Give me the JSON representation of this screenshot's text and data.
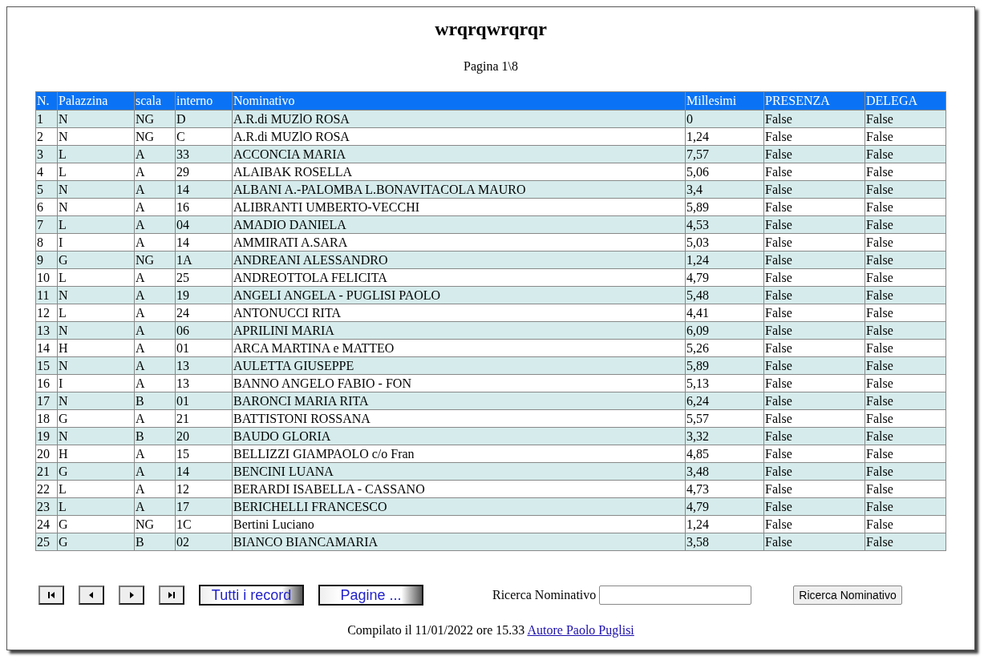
{
  "title": "wrqrqwrqrqr",
  "page_label": "Pagina 1\\8",
  "table": {
    "columns": [
      "N.",
      "Palazzina",
      "scala",
      "interno",
      "Nominativo",
      "Millesimi",
      "PRESENZA",
      "DELEGA"
    ],
    "rows": [
      [
        "1",
        "N",
        "NG",
        "D",
        "A.R.di MUZlO ROSA",
        "0",
        "False",
        "False"
      ],
      [
        "2",
        "N",
        "NG",
        "C",
        "A.R.di MUZlO ROSA",
        "1,24",
        "False",
        "False"
      ],
      [
        "3",
        "L",
        "A",
        "33",
        "ACCONCIA MARIA",
        "7,57",
        "False",
        "False"
      ],
      [
        "4",
        "L",
        "A",
        "29",
        "ALAIBAK ROSELLA",
        "5,06",
        "False",
        "False"
      ],
      [
        "5",
        "N",
        "A",
        "14",
        "ALBANI A.-PALOMBA L.BONAVITACOLA MAURO",
        "3,4",
        "False",
        "False"
      ],
      [
        "6",
        "N",
        "A",
        "16",
        "ALIBRANTI UMBERTO-VECCHI",
        "5,89",
        "False",
        "False"
      ],
      [
        "7",
        "L",
        "A",
        "04",
        "AMADIO DANIELA",
        "4,53",
        "False",
        "False"
      ],
      [
        "8",
        "I",
        "A",
        "14",
        "AMMIRATI A.SARA",
        "5,03",
        "False",
        "False"
      ],
      [
        "9",
        "G",
        "NG",
        "1A",
        "ANDREANI ALESSANDRO",
        "1,24",
        "False",
        "False"
      ],
      [
        "10",
        "L",
        "A",
        "25",
        "ANDREOTTOLA FELICITA",
        "4,79",
        "False",
        "False"
      ],
      [
        "11",
        "N",
        "A",
        "19",
        "ANGELI ANGELA - PUGLISI PAOLO",
        "5,48",
        "False",
        "False"
      ],
      [
        "12",
        "L",
        "A",
        "24",
        "ANTONUCCI RITA",
        "4,41",
        "False",
        "False"
      ],
      [
        "13",
        "N",
        "A",
        "06",
        "APRILINI MARIA",
        "6,09",
        "False",
        "False"
      ],
      [
        "14",
        "H",
        "A",
        "01",
        "ARCA MARTINA e MATTEO",
        "5,26",
        "False",
        "False"
      ],
      [
        "15",
        "N",
        "A",
        "13",
        "AULETTA GIUSEPPE",
        "5,89",
        "False",
        "False"
      ],
      [
        "16",
        "I",
        "A",
        "13",
        "BANNO ANGELO FABIO - FON",
        "5,13",
        "False",
        "False"
      ],
      [
        "17",
        "N",
        "B",
        "01",
        "BARONCI MARIA RITA",
        "6,24",
        "False",
        "False"
      ],
      [
        "18",
        "G",
        "A",
        "21",
        "BATTISTONI ROSSANA",
        "5,57",
        "False",
        "False"
      ],
      [
        "19",
        "N",
        "B",
        "20",
        "BAUDO GLORIA",
        "3,32",
        "False",
        "False"
      ],
      [
        "20",
        "H",
        "A",
        "15",
        "BELLIZZI GIAMPAOLO c/o Fran",
        "4,85",
        "False",
        "False"
      ],
      [
        "21",
        "G",
        "A",
        "14",
        "BENCINI LUANA",
        "3,48",
        "False",
        "False"
      ],
      [
        "22",
        "L",
        "A",
        "12",
        "BERARDI ISABELLA - CASSANO",
        "4,73",
        "False",
        "False"
      ],
      [
        "23",
        "L",
        "A",
        "17",
        "BERICHELLI FRANCESCO",
        "4,79",
        "False",
        "False"
      ],
      [
        "24",
        "G",
        "NG",
        "1C",
        "Bertini Luciano",
        "1,24",
        "False",
        "False"
      ],
      [
        "25",
        "G",
        "B",
        "02",
        "BIANCO BIANCAMARIA",
        "3,58",
        "False",
        "False"
      ]
    ]
  },
  "nav_buttons": [
    {
      "kind": "first"
    },
    {
      "kind": "prev"
    },
    {
      "kind": "next"
    },
    {
      "kind": "last"
    }
  ],
  "image_buttons": [
    "Tutti i record",
    "Pagine ..."
  ],
  "search": {
    "label": "Ricerca Nominativo",
    "button": "Ricerca Nominativo"
  },
  "footer": {
    "text": "Compilato il 11/01/2022 ore 15.33",
    "link": "Autore Paolo Puglisi"
  }
}
